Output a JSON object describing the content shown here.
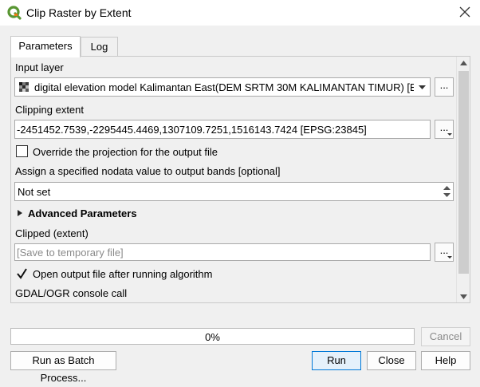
{
  "window": {
    "title": "Clip Raster by Extent",
    "close_icon": "close-icon",
    "logo_icon": "qgis-logo-icon"
  },
  "tabs": [
    {
      "label": "Parameters",
      "active": true
    },
    {
      "label": "Log",
      "active": false
    }
  ],
  "params": {
    "input_layer_label": "Input layer",
    "input_layer_value": "digital elevation model Kalimantan East(DEM SRTM 30M KALIMANTAN TIMUR) [EPSG:",
    "input_layer_ellipsis": "...",
    "clipping_extent_label": "Clipping extent",
    "clipping_extent_value": "-2451452.7539,-2295445.4469,1307109.7251,1516143.7424 [EPSG:23845]",
    "clipping_extent_ellipsis": "...",
    "override_projection_label": "Override the projection for the output file",
    "override_projection_checked": false,
    "nodata_label": "Assign a specified nodata value to output bands [optional]",
    "nodata_value": "Not set",
    "advanced_label": "Advanced Parameters",
    "clipped_label": "Clipped (extent)",
    "clipped_placeholder": "[Save to temporary file]",
    "clipped_ellipsis": "...",
    "open_output_label": "Open output file after running algorithm",
    "open_output_checked": true,
    "console_label": "GDAL/OGR console call"
  },
  "progress": {
    "percent_text": "0%",
    "value": 0
  },
  "buttons": {
    "cancel": "Cancel",
    "batch": "Run as Batch Process...",
    "run": "Run",
    "close": "Close",
    "help": "Help"
  },
  "colors": {
    "accent": "#0078d7",
    "qgis_green": "#589632"
  }
}
